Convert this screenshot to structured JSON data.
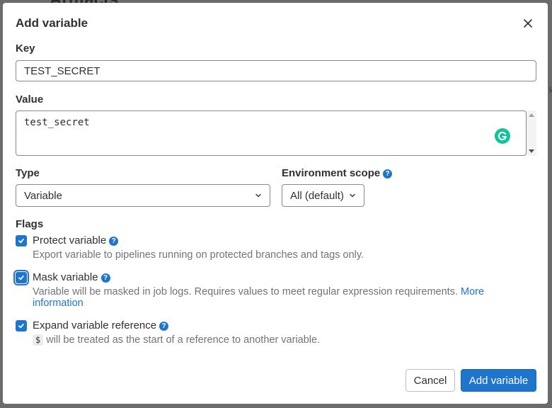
{
  "modal": {
    "title": "Add variable"
  },
  "key_field": {
    "label": "Key",
    "value": "TEST_SECRET"
  },
  "value_field": {
    "label": "Value",
    "value": "test_secret"
  },
  "type_field": {
    "label": "Type",
    "selected": "Variable"
  },
  "environment_field": {
    "label": "Environment scope",
    "selected": "All (default)"
  },
  "flags": {
    "heading": "Flags",
    "protect": {
      "label": "Protect variable",
      "checked": true,
      "help": "Export variable to pipelines running on protected branches and tags only."
    },
    "mask": {
      "label": "Mask variable",
      "checked": true,
      "help": "Variable will be masked in job logs. Requires values to meet regular expression requirements.",
      "link_text_1": "More",
      "link_text_2": "information"
    },
    "expand": {
      "label": "Expand variable reference",
      "checked": true,
      "code": "$",
      "help": "will be treated as the start of a reference to another variable."
    }
  },
  "buttons": {
    "cancel": "Cancel",
    "add": "Add variable"
  },
  "icons": {
    "close": "close-icon",
    "help": "question-circle-icon",
    "check": "check-icon",
    "chevron": "chevron-down-icon",
    "grammarly": "grammarly-icon"
  },
  "colors": {
    "primary": "#1f75cb",
    "grammarly": "#15c39a",
    "help_text": "#737278"
  }
}
